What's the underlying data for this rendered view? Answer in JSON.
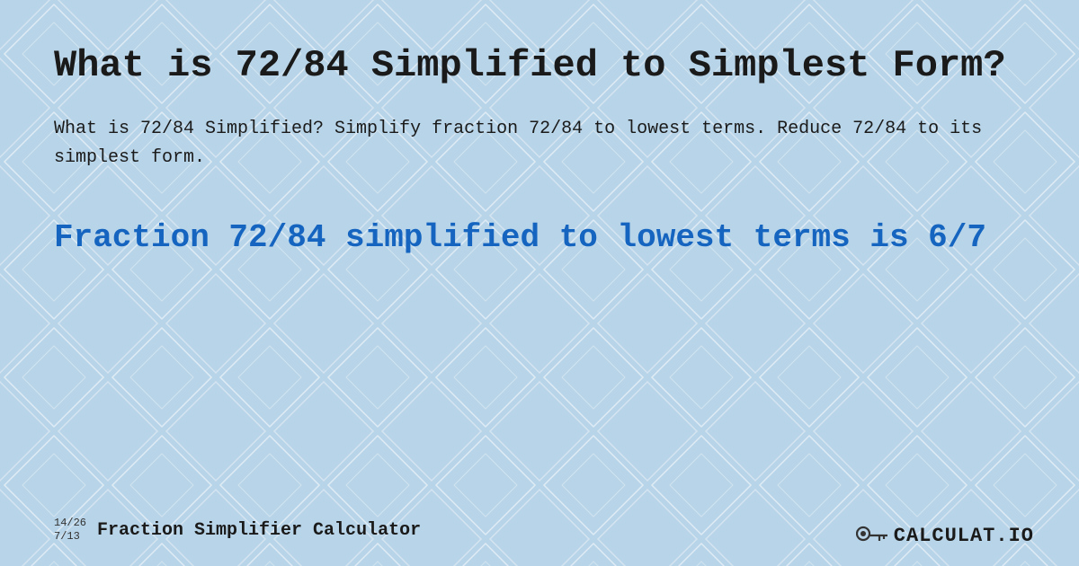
{
  "page": {
    "background_color": "#c5ddef",
    "title": "What is 72/84 Simplified to Simplest Form?",
    "description": "What is 72/84 Simplified? Simplify fraction 72/84 to lowest terms. Reduce 72/84 to its simplest form.",
    "result_heading": "Fraction 72/84 simplified to lowest terms is 6/7",
    "footer": {
      "fraction_top": "14/26",
      "fraction_bottom": "7/13",
      "label": "Fraction Simplifier Calculator",
      "logo_text": "CALCULAT.IO"
    }
  }
}
